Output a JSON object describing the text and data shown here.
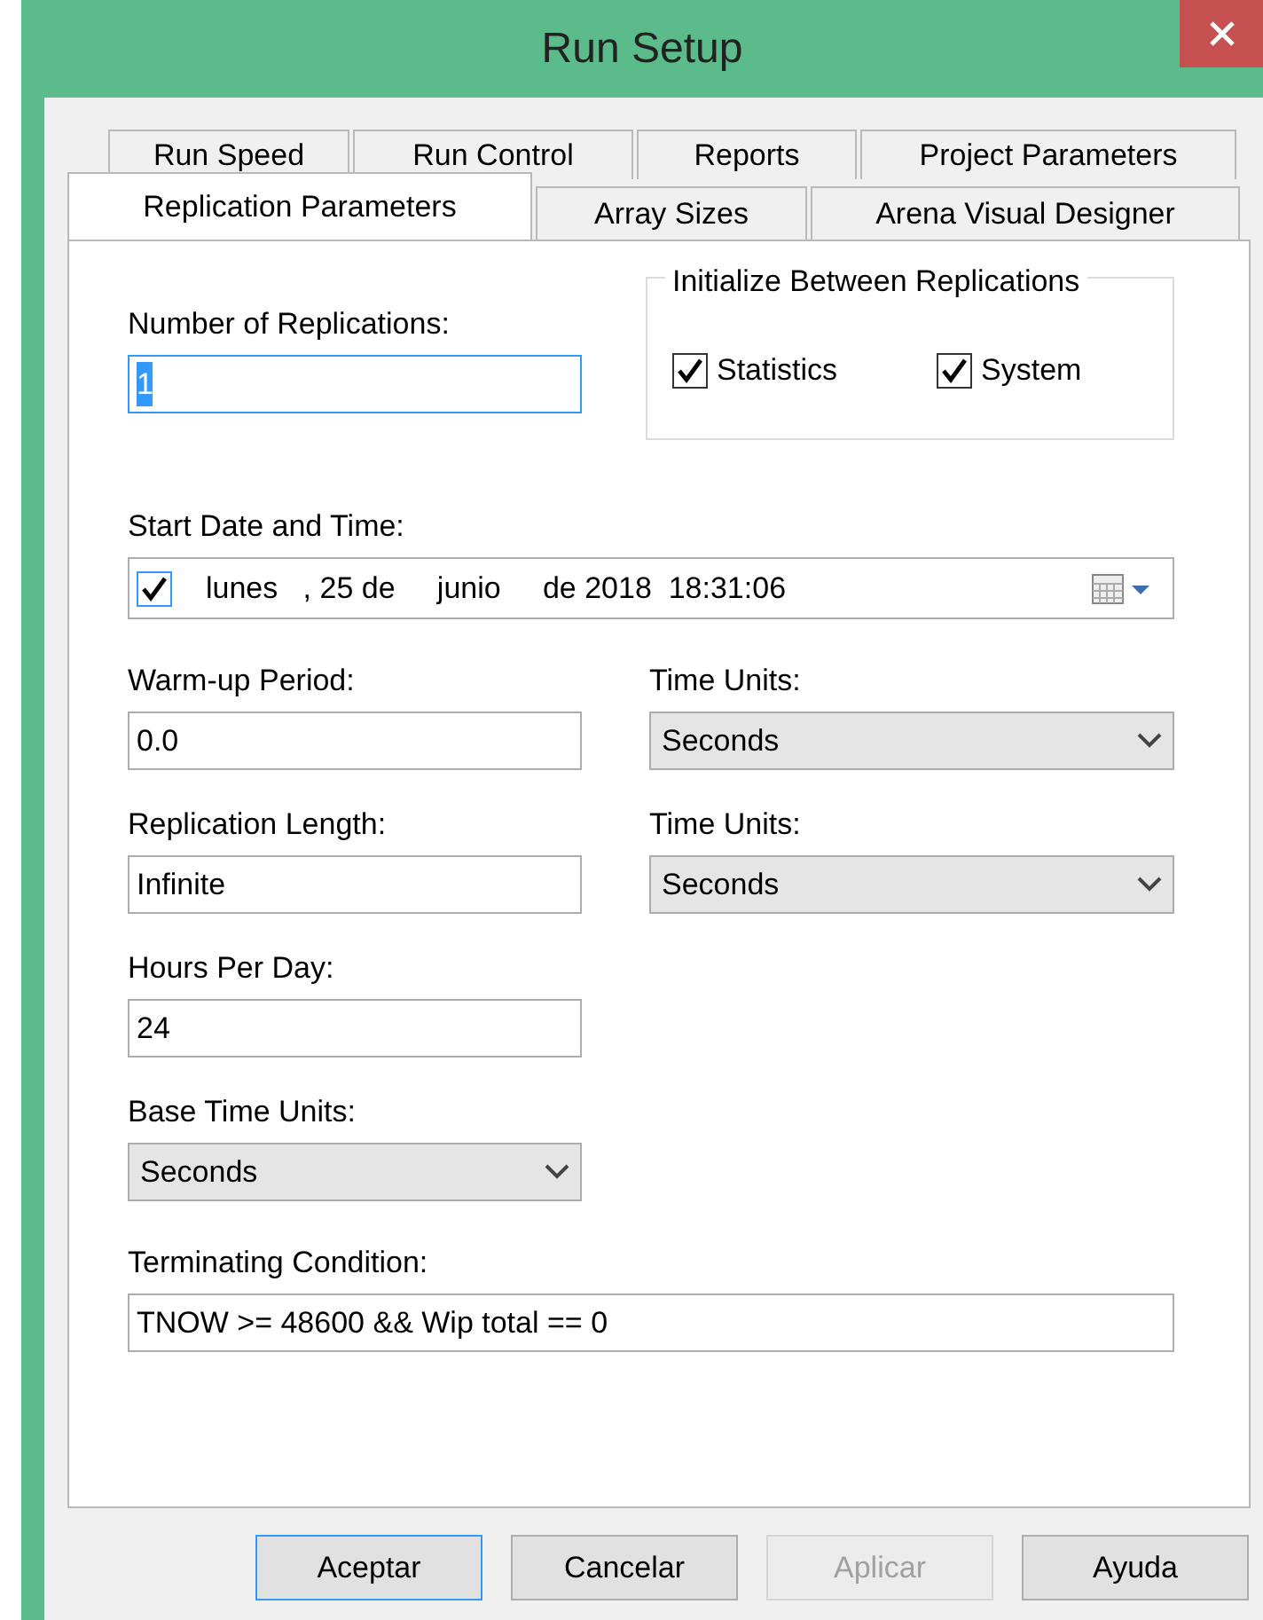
{
  "window": {
    "title": "Run Setup"
  },
  "tab_rows": [
    [
      {
        "label": "Run Speed",
        "selected": false
      },
      {
        "label": "Run Control",
        "selected": false
      },
      {
        "label": "Reports",
        "selected": false
      },
      {
        "label": "Project Parameters",
        "selected": false
      }
    ],
    [
      {
        "label": "Replication Parameters",
        "selected": true
      },
      {
        "label": "Array Sizes",
        "selected": false
      },
      {
        "label": "Arena Visual Designer",
        "selected": false
      }
    ]
  ],
  "replications": {
    "label": "Number of Replications:",
    "value": "1",
    "value_selected": true
  },
  "initialize": {
    "title": "Initialize Between Replications",
    "options": [
      {
        "label": "Statistics",
        "checked": true
      },
      {
        "label": "System",
        "checked": true
      }
    ]
  },
  "start": {
    "label": "Start Date and Time:",
    "checked": true,
    "value": "lunes   , 25 de     junio     de 2018  18:31:06"
  },
  "rows": [
    {
      "left": {
        "kind": "text",
        "label": "Warm-up Period:",
        "value": "0.0"
      },
      "right": {
        "kind": "select",
        "label": "Time Units:",
        "value": "Seconds"
      }
    },
    {
      "left": {
        "kind": "text",
        "label": "Replication Length:",
        "value": "Infinite"
      },
      "right": {
        "kind": "select",
        "label": "Time Units:",
        "value": "Seconds"
      }
    },
    {
      "left": {
        "kind": "text",
        "label": "Hours Per Day:",
        "value": "24"
      }
    },
    {
      "left": {
        "kind": "select",
        "label": "Base Time Units:",
        "value": "Seconds"
      }
    }
  ],
  "terminating": {
    "label": "Terminating Condition:",
    "value": "TNOW >= 48600 && Wip total == 0"
  },
  "buttons": [
    {
      "label": "Aceptar",
      "default": true,
      "disabled": false
    },
    {
      "label": "Cancelar",
      "default": false,
      "disabled": false
    },
    {
      "label": "Aplicar",
      "default": false,
      "disabled": true
    },
    {
      "label": "Ayuda",
      "default": false,
      "disabled": false
    }
  ]
}
